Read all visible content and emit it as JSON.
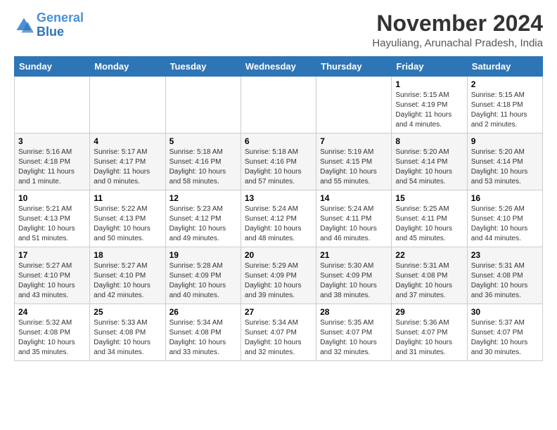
{
  "logo": {
    "line1": "General",
    "line2": "Blue"
  },
  "title": "November 2024",
  "location": "Hayuliang, Arunachal Pradesh, India",
  "weekdays": [
    "Sunday",
    "Monday",
    "Tuesday",
    "Wednesday",
    "Thursday",
    "Friday",
    "Saturday"
  ],
  "weeks": [
    [
      {
        "day": "",
        "text": ""
      },
      {
        "day": "",
        "text": ""
      },
      {
        "day": "",
        "text": ""
      },
      {
        "day": "",
        "text": ""
      },
      {
        "day": "",
        "text": ""
      },
      {
        "day": "1",
        "text": "Sunrise: 5:15 AM\nSunset: 4:19 PM\nDaylight: 11 hours\nand 4 minutes."
      },
      {
        "day": "2",
        "text": "Sunrise: 5:15 AM\nSunset: 4:18 PM\nDaylight: 11 hours\nand 2 minutes."
      }
    ],
    [
      {
        "day": "3",
        "text": "Sunrise: 5:16 AM\nSunset: 4:18 PM\nDaylight: 11 hours\nand 1 minute."
      },
      {
        "day": "4",
        "text": "Sunrise: 5:17 AM\nSunset: 4:17 PM\nDaylight: 11 hours\nand 0 minutes."
      },
      {
        "day": "5",
        "text": "Sunrise: 5:18 AM\nSunset: 4:16 PM\nDaylight: 10 hours\nand 58 minutes."
      },
      {
        "day": "6",
        "text": "Sunrise: 5:18 AM\nSunset: 4:16 PM\nDaylight: 10 hours\nand 57 minutes."
      },
      {
        "day": "7",
        "text": "Sunrise: 5:19 AM\nSunset: 4:15 PM\nDaylight: 10 hours\nand 55 minutes."
      },
      {
        "day": "8",
        "text": "Sunrise: 5:20 AM\nSunset: 4:14 PM\nDaylight: 10 hours\nand 54 minutes."
      },
      {
        "day": "9",
        "text": "Sunrise: 5:20 AM\nSunset: 4:14 PM\nDaylight: 10 hours\nand 53 minutes."
      }
    ],
    [
      {
        "day": "10",
        "text": "Sunrise: 5:21 AM\nSunset: 4:13 PM\nDaylight: 10 hours\nand 51 minutes."
      },
      {
        "day": "11",
        "text": "Sunrise: 5:22 AM\nSunset: 4:13 PM\nDaylight: 10 hours\nand 50 minutes."
      },
      {
        "day": "12",
        "text": "Sunrise: 5:23 AM\nSunset: 4:12 PM\nDaylight: 10 hours\nand 49 minutes."
      },
      {
        "day": "13",
        "text": "Sunrise: 5:24 AM\nSunset: 4:12 PM\nDaylight: 10 hours\nand 48 minutes."
      },
      {
        "day": "14",
        "text": "Sunrise: 5:24 AM\nSunset: 4:11 PM\nDaylight: 10 hours\nand 46 minutes."
      },
      {
        "day": "15",
        "text": "Sunrise: 5:25 AM\nSunset: 4:11 PM\nDaylight: 10 hours\nand 45 minutes."
      },
      {
        "day": "16",
        "text": "Sunrise: 5:26 AM\nSunset: 4:10 PM\nDaylight: 10 hours\nand 44 minutes."
      }
    ],
    [
      {
        "day": "17",
        "text": "Sunrise: 5:27 AM\nSunset: 4:10 PM\nDaylight: 10 hours\nand 43 minutes."
      },
      {
        "day": "18",
        "text": "Sunrise: 5:27 AM\nSunset: 4:10 PM\nDaylight: 10 hours\nand 42 minutes."
      },
      {
        "day": "19",
        "text": "Sunrise: 5:28 AM\nSunset: 4:09 PM\nDaylight: 10 hours\nand 40 minutes."
      },
      {
        "day": "20",
        "text": "Sunrise: 5:29 AM\nSunset: 4:09 PM\nDaylight: 10 hours\nand 39 minutes."
      },
      {
        "day": "21",
        "text": "Sunrise: 5:30 AM\nSunset: 4:09 PM\nDaylight: 10 hours\nand 38 minutes."
      },
      {
        "day": "22",
        "text": "Sunrise: 5:31 AM\nSunset: 4:08 PM\nDaylight: 10 hours\nand 37 minutes."
      },
      {
        "day": "23",
        "text": "Sunrise: 5:31 AM\nSunset: 4:08 PM\nDaylight: 10 hours\nand 36 minutes."
      }
    ],
    [
      {
        "day": "24",
        "text": "Sunrise: 5:32 AM\nSunset: 4:08 PM\nDaylight: 10 hours\nand 35 minutes."
      },
      {
        "day": "25",
        "text": "Sunrise: 5:33 AM\nSunset: 4:08 PM\nDaylight: 10 hours\nand 34 minutes."
      },
      {
        "day": "26",
        "text": "Sunrise: 5:34 AM\nSunset: 4:08 PM\nDaylight: 10 hours\nand 33 minutes."
      },
      {
        "day": "27",
        "text": "Sunrise: 5:34 AM\nSunset: 4:07 PM\nDaylight: 10 hours\nand 32 minutes."
      },
      {
        "day": "28",
        "text": "Sunrise: 5:35 AM\nSunset: 4:07 PM\nDaylight: 10 hours\nand 32 minutes."
      },
      {
        "day": "29",
        "text": "Sunrise: 5:36 AM\nSunset: 4:07 PM\nDaylight: 10 hours\nand 31 minutes."
      },
      {
        "day": "30",
        "text": "Sunrise: 5:37 AM\nSunset: 4:07 PM\nDaylight: 10 hours\nand 30 minutes."
      }
    ]
  ]
}
